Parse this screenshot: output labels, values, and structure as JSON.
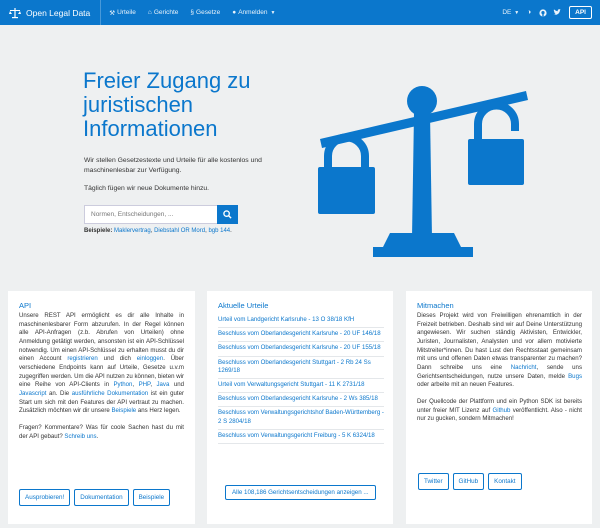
{
  "navbar": {
    "brand": "Open Legal Data",
    "links": [
      {
        "icon": "gavel-icon",
        "label": "Urteile"
      },
      {
        "icon": "bank-icon",
        "label": "Gerichte"
      },
      {
        "icon": "paragraph-icon",
        "label": "Gesetze"
      },
      {
        "icon": "user-icon",
        "label": "Anmelden"
      }
    ],
    "language": "DE",
    "api_label": "API"
  },
  "hero": {
    "title": "Freier Zugang zu juristischen Informationen",
    "subtitle": "Wir stellen Gesetzestexte und Urteile für alle kostenlos und maschinenlesbar zur Verfügung.",
    "daily": "Täglich fügen wir neue Dokumente hinzu.",
    "search_placeholder": "Normen, Entscheidungen, ...",
    "examples_label": "Beispiele",
    "examples": [
      "Maklervertrag",
      "Diebstahl OR Mord",
      "bgb 144"
    ]
  },
  "api_card": {
    "title": "API",
    "p1_a": "Unsere REST API ermöglicht es dir alle Inhalte in maschinenlesbarer Form abzurufen. In der Regel können alle API-Anfragen (z.b. Abrufen von Urteilen) ohne Anmeldung getätigt werden, ansonsten ist ein API-Schlüssel notwendig. Um einen API-Schlüssel zu erhalten musst du dir einen Account ",
    "link_register": "registrieren",
    "p1_b": " und dich ",
    "link_login": "einloggen",
    "p1_c": ". Über verschiedene Endpoints kann auf Urteile, Gesetze u.v.m zugegriffen werden. Um die API nutzen zu können, bieten wir eine Reihe von API-Clients in ",
    "link_python": "Python",
    "sep1": ", ",
    "link_php": "PHP",
    "sep2": ", ",
    "link_java": "Java",
    "p1_d": " und ",
    "link_js": "Javascript",
    "p1_e": " an. Die ",
    "link_docs": "ausführliche Dokumentation",
    "p1_f": " ist ein guter Start um sich mit den Features der API vertraut zu machen. Zusätzlich möchten wir dir unsere ",
    "link_examples": "Beispiele",
    "p1_g": " ans Herz legen.",
    "p2_a": "Fragen? Kommentare? Was für coole Sachen hast du mit der API gebaut? ",
    "link_write": "Schreib uns",
    "p2_b": ".",
    "buttons": [
      "Ausprobieren!",
      "Dokumentation",
      "Beispiele"
    ]
  },
  "urteile_card": {
    "title": "Aktuelle Urteile",
    "items": [
      "Urteil vom Landgericht Karlsruhe - 13 O 38/18 KfH",
      "Beschluss vom Oberlandesgericht Karlsruhe - 20 UF 146/18",
      "Beschluss vom Oberlandesgericht Karlsruhe - 20 UF 155/18",
      "Beschluss vom Oberlandesgericht Stuttgart - 2 Rb 24 Ss 1269/18",
      "Urteil vom Verwaltungsgericht Stuttgart - 11 K 2731/18",
      "Beschluss vom Oberlandesgericht Karlsruhe - 2 Ws 385/18",
      "Beschluss vom Verwaltungsgerichtshof Baden-Württemberg - 2 S 2804/18",
      "Beschluss vom Verwaltungsgericht Freiburg - 5 K 6324/18"
    ],
    "all_button": "Alle 108,186 Gerichtsentscheidungen anzeigen ..."
  },
  "mit_card": {
    "title": "Mitmachen",
    "p1_a": "Dieses Projekt wird von Freiwilligen ehrenamtlich in der Freizeit betrieben. Deshalb sind wir auf Deine Unterstützung angewiesen. Wir suchen ständig Aktivisten, Entwickler, Juristen, Journalisten, Analysten und vor allem motivierte Mitstreiter*innen. Du hast Lust den Rechtsstaat gemeinsam mit uns und offenen Daten etwas transparenter zu machen? Dann schreibe uns eine ",
    "link_msg": "Nachricht",
    "p1_b": ", sende uns Gerichtsentscheidungen, nutze unsere Daten, melde ",
    "link_bugs": "Bugs",
    "p1_c": " oder arbeite mit an neuen Features.",
    "p2_a": "Der Quellcode der Plattform und ein Python SDK ist bereits unter freier MIT Lizenz auf ",
    "link_github": "Github",
    "p2_b": " veröffentlicht. Also - nicht nur zu gucken, sondern Mitmachen!",
    "buttons": [
      "Twitter",
      "GitHub",
      "Kontakt"
    ]
  },
  "colors": {
    "accent": "#0b77cc",
    "background": "#eef0f1"
  }
}
